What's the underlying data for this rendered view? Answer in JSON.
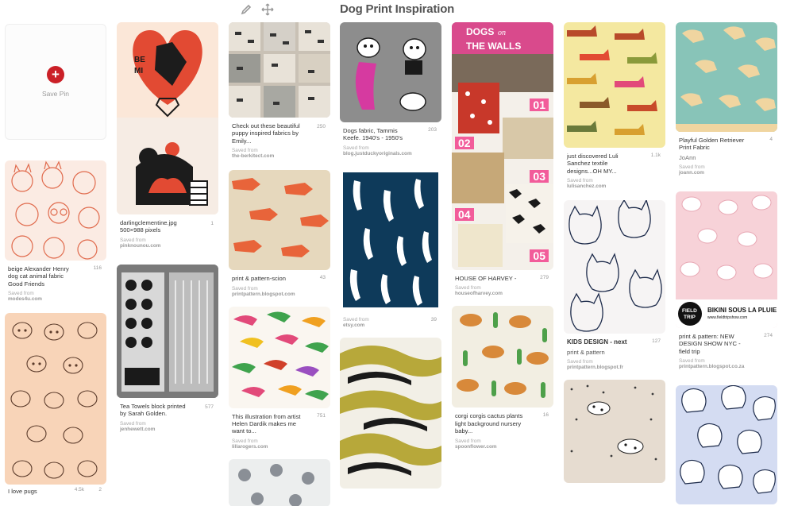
{
  "board": {
    "title": "Dog Print Inspiration"
  },
  "toolbar": {
    "edit_icon": "pencil-icon",
    "move_icon": "move-arrows-icon"
  },
  "save_card": {
    "label": "Save Pin",
    "icon": "plus-icon",
    "accent": "#cb2027"
  },
  "pins": [
    {
      "desc": "beige Alexander Henry dog cat animal fabric Good Friends",
      "repins": "116",
      "saved_label": "Saved from",
      "source": "modes4u.com"
    },
    {
      "desc": "I love pugs",
      "repins": "4.5k",
      "likes": "2"
    },
    {
      "desc": "darlingclementine.jpg 500×988 pixels",
      "repins": "1",
      "saved_label": "Saved from",
      "source": "pinknounou.com"
    },
    {
      "desc": "Tea Towels block printed by Sarah Golden.",
      "repins": "577",
      "saved_label": "Saved from",
      "source": "jenhewett.com"
    },
    {
      "desc": "Check out these beautiful puppy inspired fabrics by Emily...",
      "repins": "250",
      "saved_label": "Saved from",
      "source": "the-berkitect.com"
    },
    {
      "desc": "print & pattern-scion",
      "repins": "43",
      "saved_label": "Saved from",
      "source": "printpattern.blogspot.com"
    },
    {
      "desc": "This illustration from artist Helen Dardik makes me want to...",
      "repins": "751",
      "saved_label": "Saved from",
      "source": "lillarogers.com"
    },
    {
      "desc": "Dogs fabric, Tammis Keefe. 1940's - 1950's",
      "repins": "203",
      "saved_label": "Saved from",
      "source": "blog.justduckyoriginals.com"
    },
    {
      "desc": "",
      "repins": "39",
      "saved_label": "Saved from",
      "source": "etsy.com"
    },
    {
      "desc": "HOUSE OF HARVEY -",
      "repins": "279",
      "saved_label": "Saved from",
      "source": "houseofharvey.com",
      "banner": "DOGS on THE WALLS",
      "numbers": [
        "01",
        "02",
        "03",
        "04",
        "05"
      ]
    },
    {
      "desc": "corgi corgis cactus plants light background nursery baby...",
      "repins": "16",
      "saved_label": "Saved from",
      "source": "spoonflower.com"
    },
    {
      "desc": "just discovered Luli Sanchez textile designs...OH MY...",
      "repins": "1.1k",
      "saved_label": "Saved from",
      "source": "lulisanchez.com"
    },
    {
      "desc": "KIDS DESIGN - next",
      "sub": "print & pattern",
      "repins": "127",
      "saved_label": "Saved from",
      "source": "printpattern.blogspot.fr"
    },
    {
      "desc": "Playful Golden Retriever Print Fabric",
      "sub": "JoAnn",
      "repins": "4",
      "saved_label": "Saved from",
      "source": "joann.com"
    },
    {
      "desc": "print & pattern: NEW DESIGN SHOW NYC - field trip",
      "repins": "274",
      "saved_label": "Saved from",
      "source": "printpattern.blogspot.co.za",
      "badge": "FIELD TRIP",
      "caption": "BIKINI SOUS LA PLUIE",
      "caption_url": "www.fieldtripshow.com"
    }
  ]
}
